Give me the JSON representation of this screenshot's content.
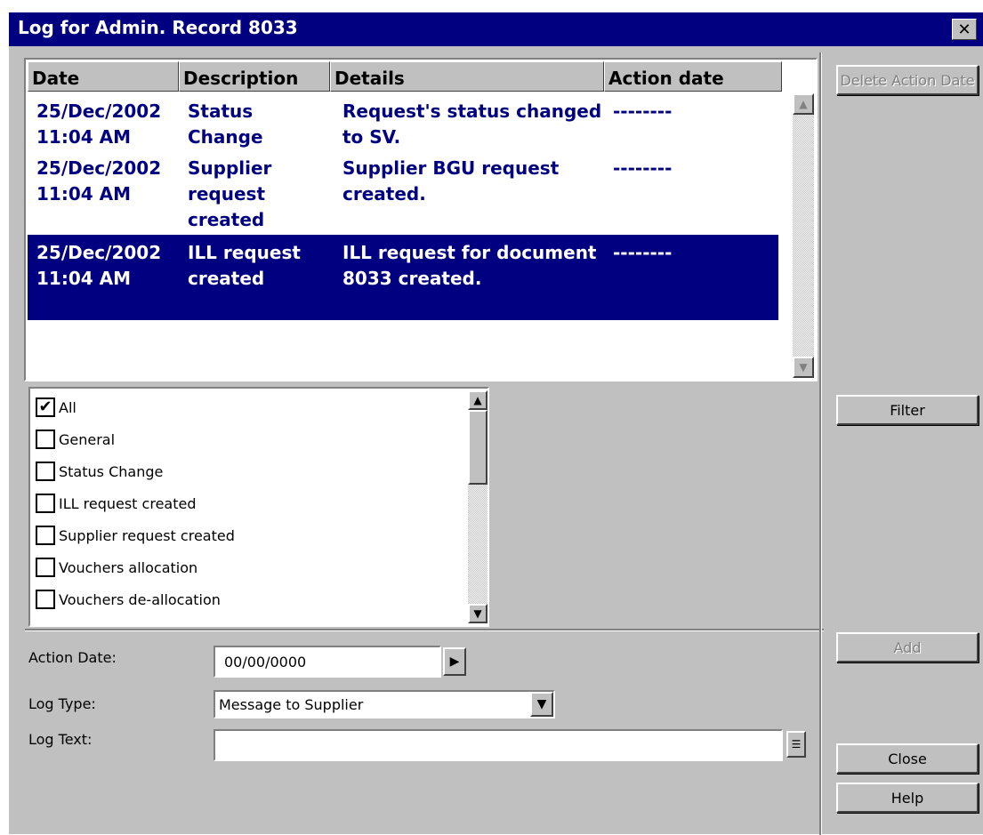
{
  "window": {
    "title": "Log for Admin. Record 8033"
  },
  "log_table": {
    "columns": [
      "Date",
      "Description",
      "Details",
      "Action date"
    ],
    "rows": [
      {
        "date": "25/Dec/2002 11:04 AM",
        "description": "Status Change",
        "details": "Request's status changed to SV.",
        "action_date": "--------",
        "selected": false
      },
      {
        "date": "25/Dec/2002 11:04 AM",
        "description": "Supplier request created",
        "details": "Supplier BGU request created.",
        "action_date": "--------",
        "selected": false
      },
      {
        "date": "25/Dec/2002 11:04 AM",
        "description": "ILL request created",
        "details": "ILL request for document 8033 created.",
        "action_date": "--------",
        "selected": true
      }
    ]
  },
  "filter_list": {
    "items": [
      {
        "label": "All",
        "checked": true
      },
      {
        "label": "General",
        "checked": false
      },
      {
        "label": "Status Change",
        "checked": false
      },
      {
        "label": "ILL request created",
        "checked": false
      },
      {
        "label": "Supplier request created",
        "checked": false
      },
      {
        "label": "Vouchers allocation",
        "checked": false
      },
      {
        "label": "Vouchers de-allocation",
        "checked": false
      }
    ]
  },
  "form": {
    "action_date_label": "Action Date:",
    "action_date_value": "00/00/0000",
    "log_type_label": "Log Type:",
    "log_type_value": "Message to Supplier",
    "log_text_label": "Log Text:",
    "log_text_value": ""
  },
  "buttons": {
    "delete_action_date": "Delete Action Date",
    "filter": "Filter",
    "add": "Add",
    "close": "Close",
    "help": "Help"
  }
}
